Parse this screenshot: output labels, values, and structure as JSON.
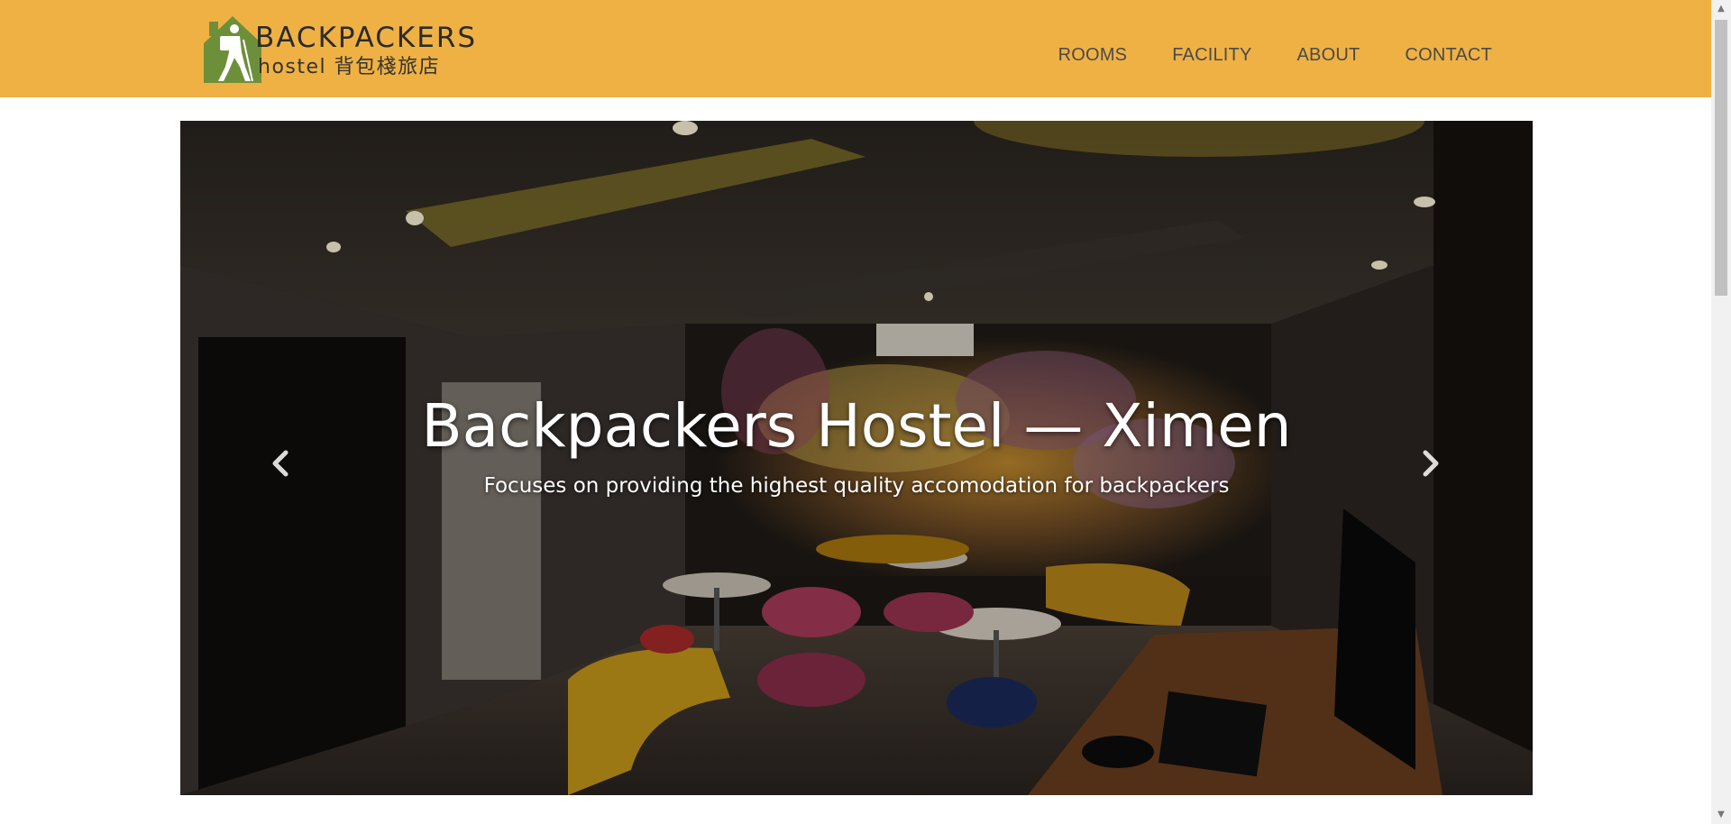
{
  "header": {
    "logo": {
      "title": "BACKPACKERS",
      "subtitle": "hostel 背包棧旅店"
    },
    "nav": [
      {
        "label": "ROOMS"
      },
      {
        "label": "FACILITY"
      },
      {
        "label": "ABOUT"
      },
      {
        "label": "CONTACT"
      }
    ],
    "background_color": "#efb143",
    "logo_green": "#6e8f3a"
  },
  "hero": {
    "title": "Backpackers Hostel — Ximen",
    "subtitle": "Focuses on providing the highest quality accomodation for backpackers",
    "prev_icon": "chevron-left-icon",
    "next_icon": "chevron-right-icon"
  },
  "scrollbar": {
    "up_icon": "▲",
    "down_icon": "▼"
  }
}
